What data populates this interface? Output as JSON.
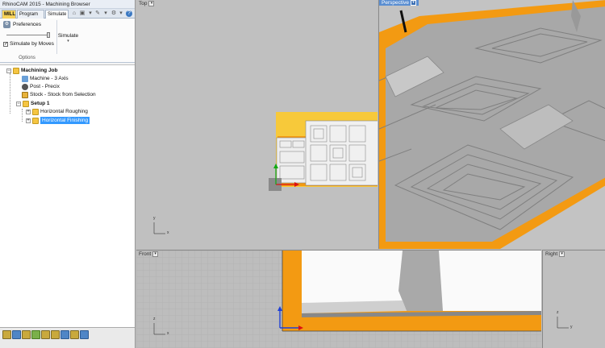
{
  "app": {
    "title": "RhinoCAM 2015 - Machining Browser"
  },
  "tabs": {
    "mill": "MILL",
    "program": "Program",
    "simulate": "Simulate"
  },
  "ribbon": {
    "preferences": "Preferences",
    "simulate_by_moves": "Simulate by Moves",
    "simulate_by_moves_checked": true,
    "simulate_button": "Simulate",
    "group_label": "Options"
  },
  "tree": {
    "root": "Machining Job",
    "machine": "Machine - 3 Axis",
    "post": "Post - Precix",
    "stock": "Stock - Stock from Selection",
    "setup": "Setup 1",
    "roughing": "Horizontal Roughing",
    "finishing": "Horizontal Finishing"
  },
  "viewports": {
    "top": "Top",
    "perspective": "Perspective",
    "front": "Front",
    "right": "Right"
  },
  "axes": {
    "x": "x",
    "y": "y",
    "z": "z"
  },
  "colors": {
    "stock_orange": "#f39a12",
    "selection_blue": "#3399ff",
    "mill_tab": "#f6d25a",
    "perspective_label": "#5a8ed1"
  },
  "icons": [
    "preferences-icon",
    "folder-icon",
    "machine-icon",
    "post-icon",
    "stock-icon"
  ]
}
